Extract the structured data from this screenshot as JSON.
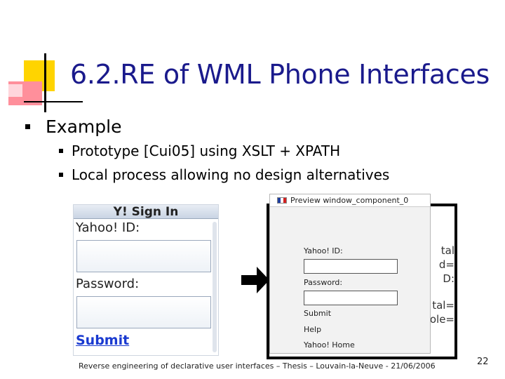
{
  "slide": {
    "title": "6.2.RE of WML Phone Interfaces",
    "bullet": "Example",
    "sub_bullets": [
      "Prototype [Cui05] using XSLT + XPATH",
      "Local process allowing no design alternatives"
    ],
    "footer": "Reverse engineering of declarative user interfaces – Thesis – Louvain-la-Neuve - 21/06/2006",
    "page_number": "22"
  },
  "yahoo_screen": {
    "title": "Y! Sign In",
    "id_label": "Yahoo! ID:",
    "password_label": "Password:",
    "submit_link": "Submit"
  },
  "frame_text": [
    "tal",
    "d=",
    "D:",
    "tal=",
    "ole="
  ],
  "preview_window": {
    "title": "Preview window_component_0",
    "id_label": "Yahoo! ID:",
    "password_label": "Password:",
    "submit": "Submit",
    "help": "Help",
    "home": "Yahoo! Home",
    "flag_colors": [
      "#1f3fa0",
      "#ffffff",
      "#d22020"
    ]
  },
  "colors": {
    "title": "#1a1a8c",
    "logo_yellow": "#ffd400",
    "logo_pink": "#ff8f9b",
    "link": "#1a3ad0"
  }
}
